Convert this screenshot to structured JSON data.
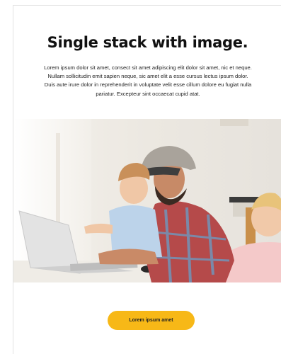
{
  "hero": {
    "title": "Single stack with image.",
    "description": "Lorem ipsum dolor sit amet, consect sit amet adipiscing elit dolor sit amet, nic et neque. Nullam sollicitudin emit sapien neque, sic amet elit a esse cursus lectus ipsum dolor. Duis aute irure dolor in reprehenderit in voluptate velit esse cillum dolore eu fugiat nulla pariatur. Excepteur sint occaecat cupid atat."
  },
  "image": {
    "subject": "family-laptop-photo"
  },
  "cta": {
    "label": "Lorem ipsum amet",
    "color": "#f7b817"
  }
}
